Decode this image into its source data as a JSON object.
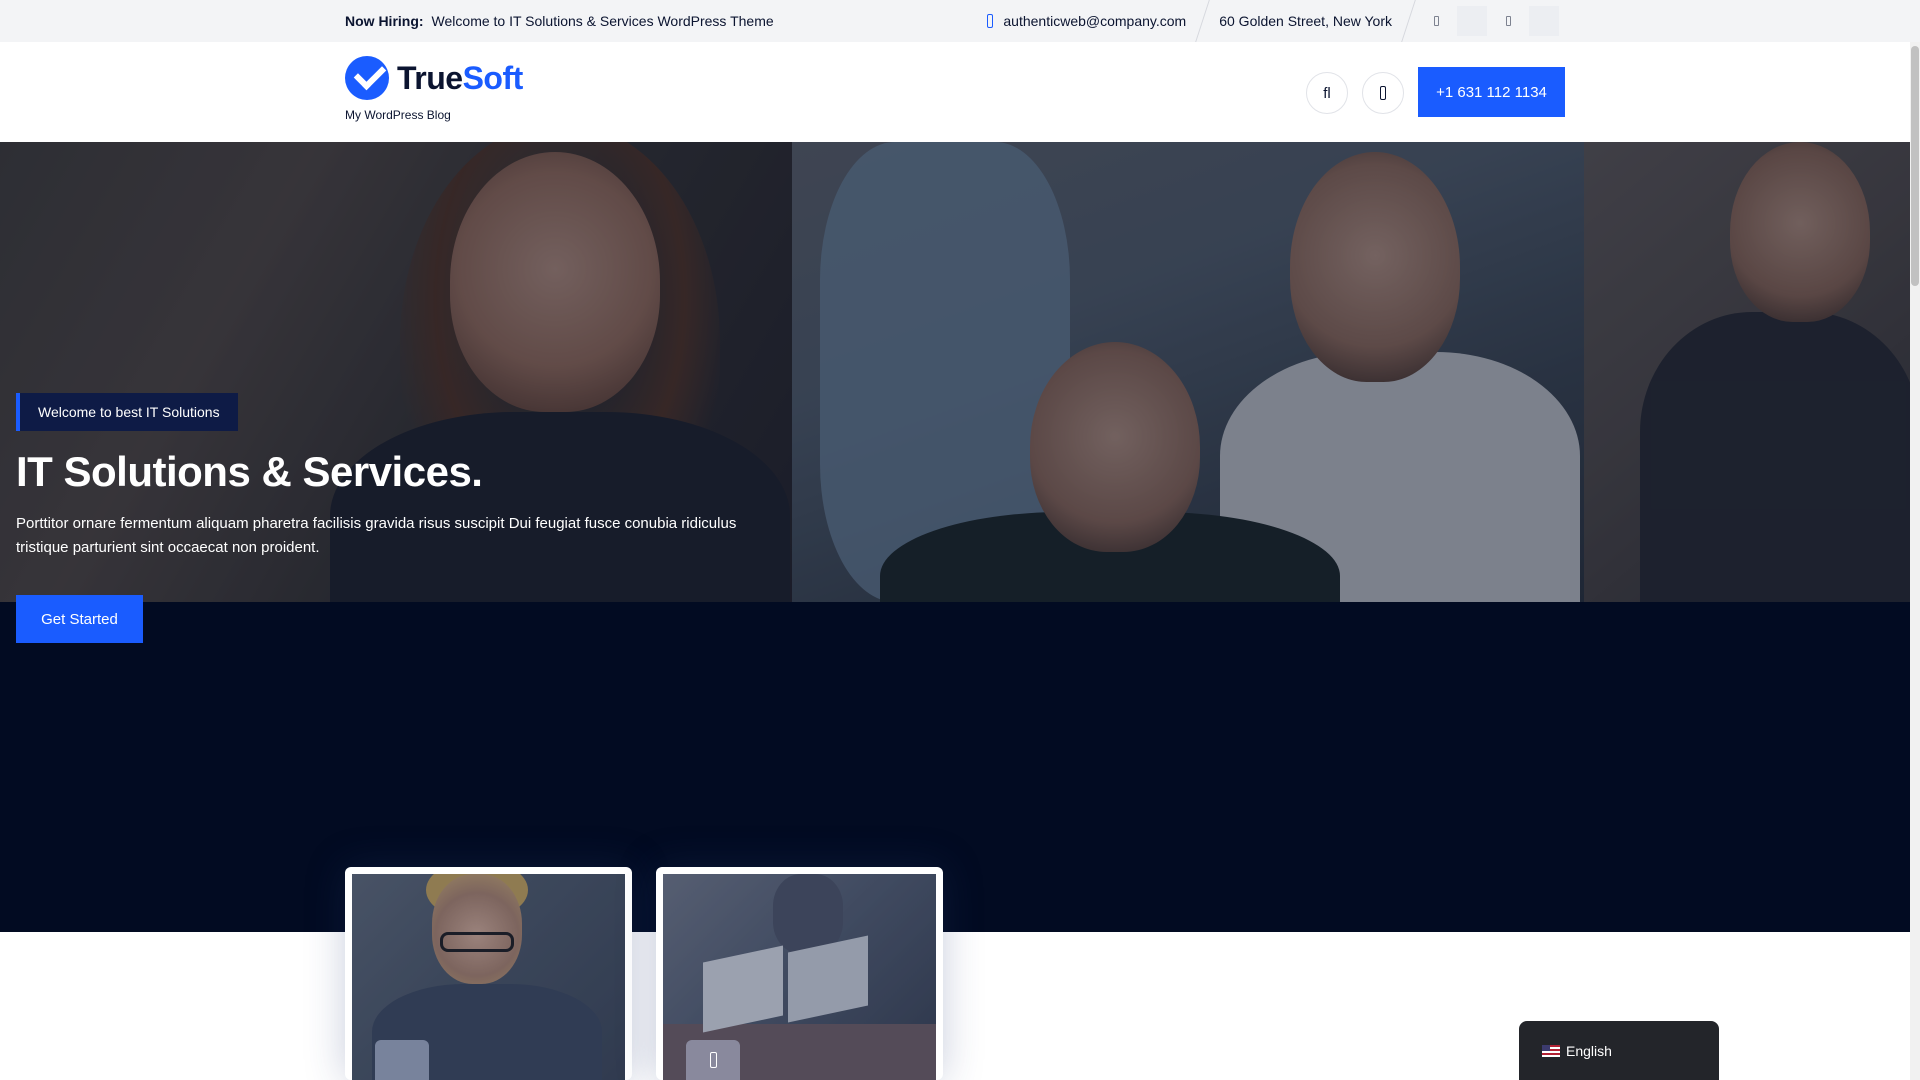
{
  "topbar": {
    "hiring_label": "Now Hiring:",
    "hiring_text": "Welcome to IT Solutions & Services WordPress Theme",
    "email": "authenticweb@company.com",
    "email_icon": "envelope-icon",
    "address": "60 Golden Street, New York",
    "social_icons": [
      "facebook-icon",
      "twitter-icon",
      "linkedin-icon",
      "instagram-icon"
    ]
  },
  "header": {
    "logo_true": "True",
    "logo_soft": "Soft",
    "tagline": "My WordPress Blog",
    "search_icon_glyph": "fl",
    "cart_icon": "cart-icon",
    "phone_label": "+1 631 112 1134"
  },
  "hero": {
    "badge": "Welcome to best IT Solutions",
    "title": "IT Solutions & Services.",
    "description": "Porttitor ornare fermentum aliquam pharetra facilisis gravida risus suscipit Dui feugiat fusce conubia ridiculus tristique parturient sint occaecat non proident.",
    "cta_label": "Get Started"
  },
  "language": {
    "label": "English"
  },
  "colors": {
    "accent": "#1a5cff",
    "dark_band": "#020b22",
    "topbar_bg": "#f3f4f6"
  }
}
